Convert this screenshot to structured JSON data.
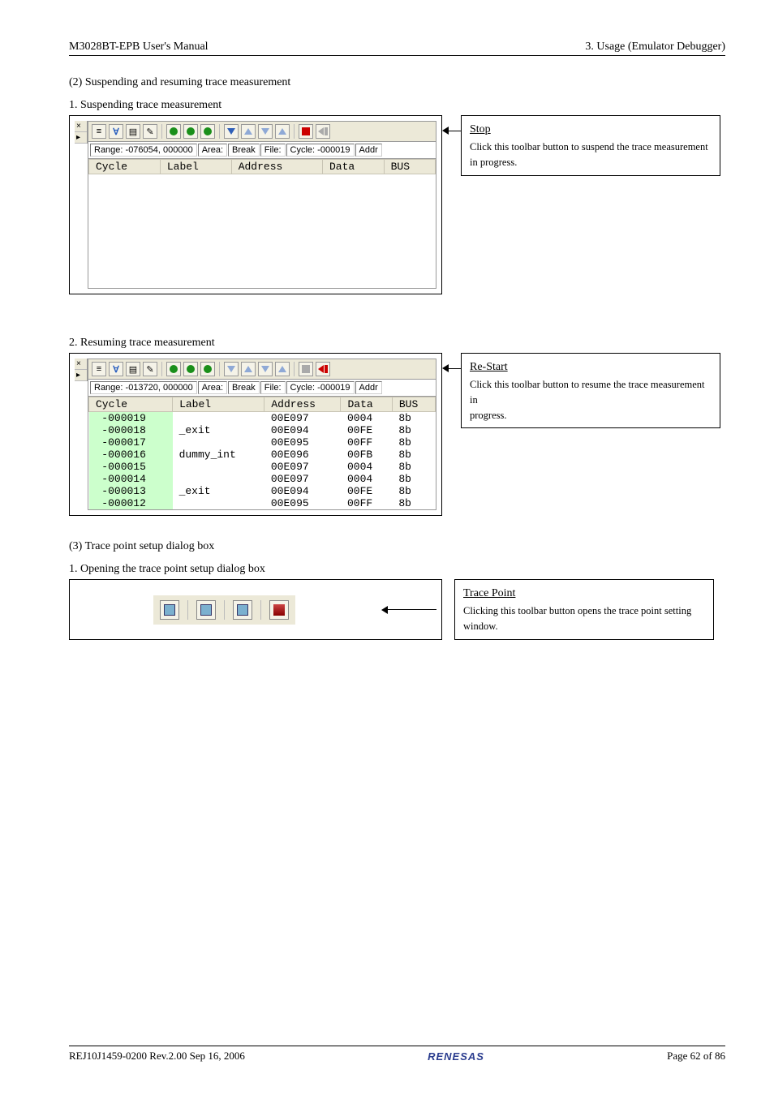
{
  "header": {
    "left": "M3028BT-EPB User's Manual",
    "right": "3. Usage (Emulator Debugger)"
  },
  "s1": {
    "title": "(2) Suspending and resuming trace measurement",
    "sub1": "1. Suspending trace measurement",
    "sub2": "2. Resuming trace measurement"
  },
  "stop": {
    "title": "Stop",
    "body1": "Click this toolbar button to suspend the trace measurement",
    "body2": "in progress."
  },
  "restart": {
    "title": "Re-Start",
    "body1": "Click this toolbar button to resume the trace measurement in",
    "body2": "progress."
  },
  "info1": {
    "range": "Range: -076054,  000000",
    "area": "Area:",
    "break": "Break",
    "file": "File:",
    "cycle": "Cycle: -000019",
    "addr": "Addr"
  },
  "info2": {
    "range": "Range: -013720,  000000",
    "area": "Area:",
    "break": "Break",
    "file": "File:",
    "cycle": "Cycle: -000019",
    "addr": "Addr"
  },
  "cols": {
    "c1": "Cycle",
    "c2": "Label",
    "c3": "Address",
    "c4": "Data",
    "c5": "BUS"
  },
  "rows": [
    {
      "cyc": "-000019",
      "lbl": "",
      "addr": "00E097",
      "data": "0004",
      "bus": "8b"
    },
    {
      "cyc": "-000018",
      "lbl": "_exit",
      "addr": "00E094",
      "data": "00FE",
      "bus": "8b"
    },
    {
      "cyc": "-000017",
      "lbl": "",
      "addr": "00E095",
      "data": "00FF",
      "bus": "8b"
    },
    {
      "cyc": "-000016",
      "lbl": "dummy_int",
      "addr": "00E096",
      "data": "00FB",
      "bus": "8b"
    },
    {
      "cyc": "-000015",
      "lbl": "",
      "addr": "00E097",
      "data": "0004",
      "bus": "8b"
    },
    {
      "cyc": "-000014",
      "lbl": "",
      "addr": "00E097",
      "data": "0004",
      "bus": "8b"
    },
    {
      "cyc": "-000013",
      "lbl": "_exit",
      "addr": "00E094",
      "data": "00FE",
      "bus": "8b"
    },
    {
      "cyc": "-000012",
      "lbl": "",
      "addr": "00E095",
      "data": "00FF",
      "bus": "8b"
    }
  ],
  "s2": {
    "title": "(3) Trace point setup dialog box",
    "sub1": "1. Opening the trace point setup dialog box"
  },
  "tracepoint": {
    "title": "Trace Point",
    "body1": "Clicking this toolbar button opens the trace point setting",
    "body2": "window."
  },
  "footer": {
    "left": "REJ10J1459-0200   Rev.2.00   Sep 16, 2006",
    "logo": "RENESAS",
    "right": "Page 62 of 86"
  },
  "xbar": {
    "x": "×",
    "p": "▸"
  },
  "glyphs": {
    "bars": "≡",
    "funnel": "∀",
    "page": "▤",
    "pencil": "✎"
  }
}
